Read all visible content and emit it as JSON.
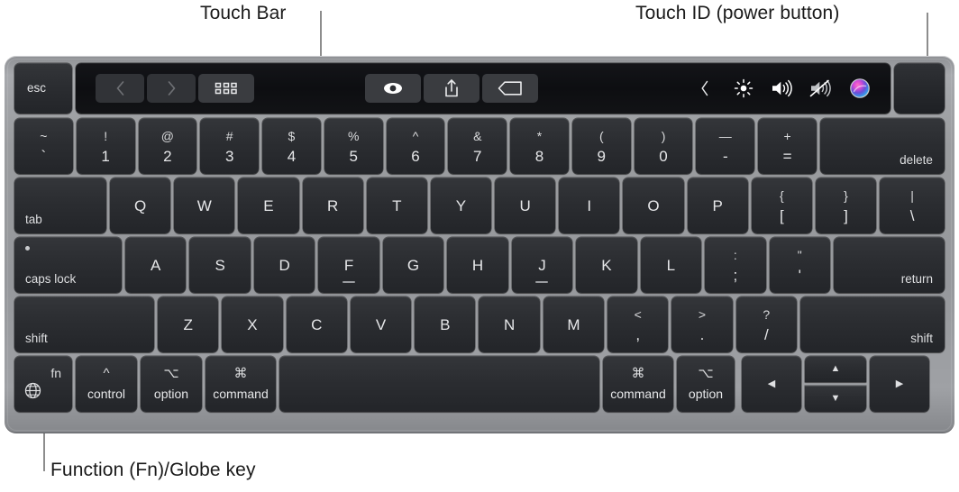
{
  "callouts": [
    {
      "id": "touch-bar",
      "label": "Touch Bar"
    },
    {
      "id": "touch-id",
      "label": "Touch ID (power button)"
    },
    {
      "id": "fn-globe",
      "label": "Function (Fn)/Globe key"
    }
  ],
  "colors": {
    "chassis": "#9a9c9f",
    "key": "#2b2d31",
    "key_text": "#e3e4e6",
    "touchbar_bg": "#0d0e11",
    "label_text": "#1a1a1a",
    "leader_line": "#8d8d8d",
    "siri_pink": "#e8519b",
    "siri_purple": "#7b4fd0",
    "siri_blue": "#3aa7f0",
    "siri_cyan": "#5fe3e0"
  },
  "touch_bar": {
    "esc_label": "esc",
    "left_buttons": [
      {
        "name": "back-icon",
        "glyph": "chevron-left",
        "state": "dimmed"
      },
      {
        "name": "forward-icon",
        "glyph": "chevron-right",
        "state": "dimmed"
      },
      {
        "name": "grid-view-icon",
        "glyph": "grid-6",
        "state": "normal"
      }
    ],
    "mid_buttons": [
      {
        "name": "quick-look-icon",
        "glyph": "eye",
        "state": "normal"
      },
      {
        "name": "share-icon",
        "glyph": "share",
        "state": "normal"
      },
      {
        "name": "tag-icon",
        "glyph": "tag",
        "state": "normal"
      }
    ],
    "control_strip": [
      {
        "name": "expand-control-strip-icon",
        "glyph": "chevron-left-thin"
      },
      {
        "name": "brightness-icon",
        "glyph": "sun"
      },
      {
        "name": "volume-up-icon",
        "glyph": "speaker-waves"
      },
      {
        "name": "mute-icon",
        "glyph": "speaker-muted"
      },
      {
        "name": "siri-icon",
        "glyph": "siri-orb"
      }
    ],
    "touch_id_label": ""
  },
  "rows": {
    "numbers": [
      {
        "top": "~",
        "bot": "`"
      },
      {
        "top": "!",
        "bot": "1"
      },
      {
        "top": "@",
        "bot": "2"
      },
      {
        "top": "#",
        "bot": "3"
      },
      {
        "top": "$",
        "bot": "4"
      },
      {
        "top": "%",
        "bot": "5"
      },
      {
        "top": "^",
        "bot": "6"
      },
      {
        "top": "&",
        "bot": "7"
      },
      {
        "top": "*",
        "bot": "8"
      },
      {
        "top": "(",
        "bot": "9"
      },
      {
        "top": ")",
        "bot": "0"
      },
      {
        "top": "—",
        "bot": "-"
      },
      {
        "top": "+",
        "bot": "="
      }
    ],
    "delete_label": "delete",
    "tab_label": "tab",
    "qwerty": [
      "Q",
      "W",
      "E",
      "R",
      "T",
      "Y",
      "U",
      "I",
      "O",
      "P"
    ],
    "qwerty_dual": [
      {
        "top": "{",
        "bot": "["
      },
      {
        "top": "}",
        "bot": "]"
      },
      {
        "top": "|",
        "bot": "\\"
      }
    ],
    "caps_label": "caps lock",
    "home": [
      "A",
      "S",
      "D",
      "F",
      "G",
      "H",
      "J",
      "K",
      "L"
    ],
    "home_dual": [
      {
        "top": ":",
        "bot": ";"
      },
      {
        "top": "\"",
        "bot": "'"
      }
    ],
    "return_label": "return",
    "shift_left_label": "shift",
    "zxcv": [
      "Z",
      "X",
      "C",
      "V",
      "B",
      "N",
      "M"
    ],
    "zxcv_dual": [
      {
        "top": "<",
        "bot": ","
      },
      {
        "top": ">",
        "bot": "."
      },
      {
        "top": "?",
        "bot": "/"
      }
    ],
    "shift_right_label": "shift",
    "bottom": {
      "fn_label": "fn",
      "globe_icon": "globe-icon",
      "control": {
        "sym": "^",
        "label": "control"
      },
      "option_left": {
        "sym": "⌥",
        "label": "option"
      },
      "command_left": {
        "sym": "⌘",
        "label": "command"
      },
      "space_label": "",
      "command_right": {
        "sym": "⌘",
        "label": "command"
      },
      "option_right": {
        "sym": "⌥",
        "label": "option"
      },
      "arrows": {
        "left": "◀",
        "up": "▲",
        "down": "▼",
        "right": "▶"
      }
    }
  }
}
